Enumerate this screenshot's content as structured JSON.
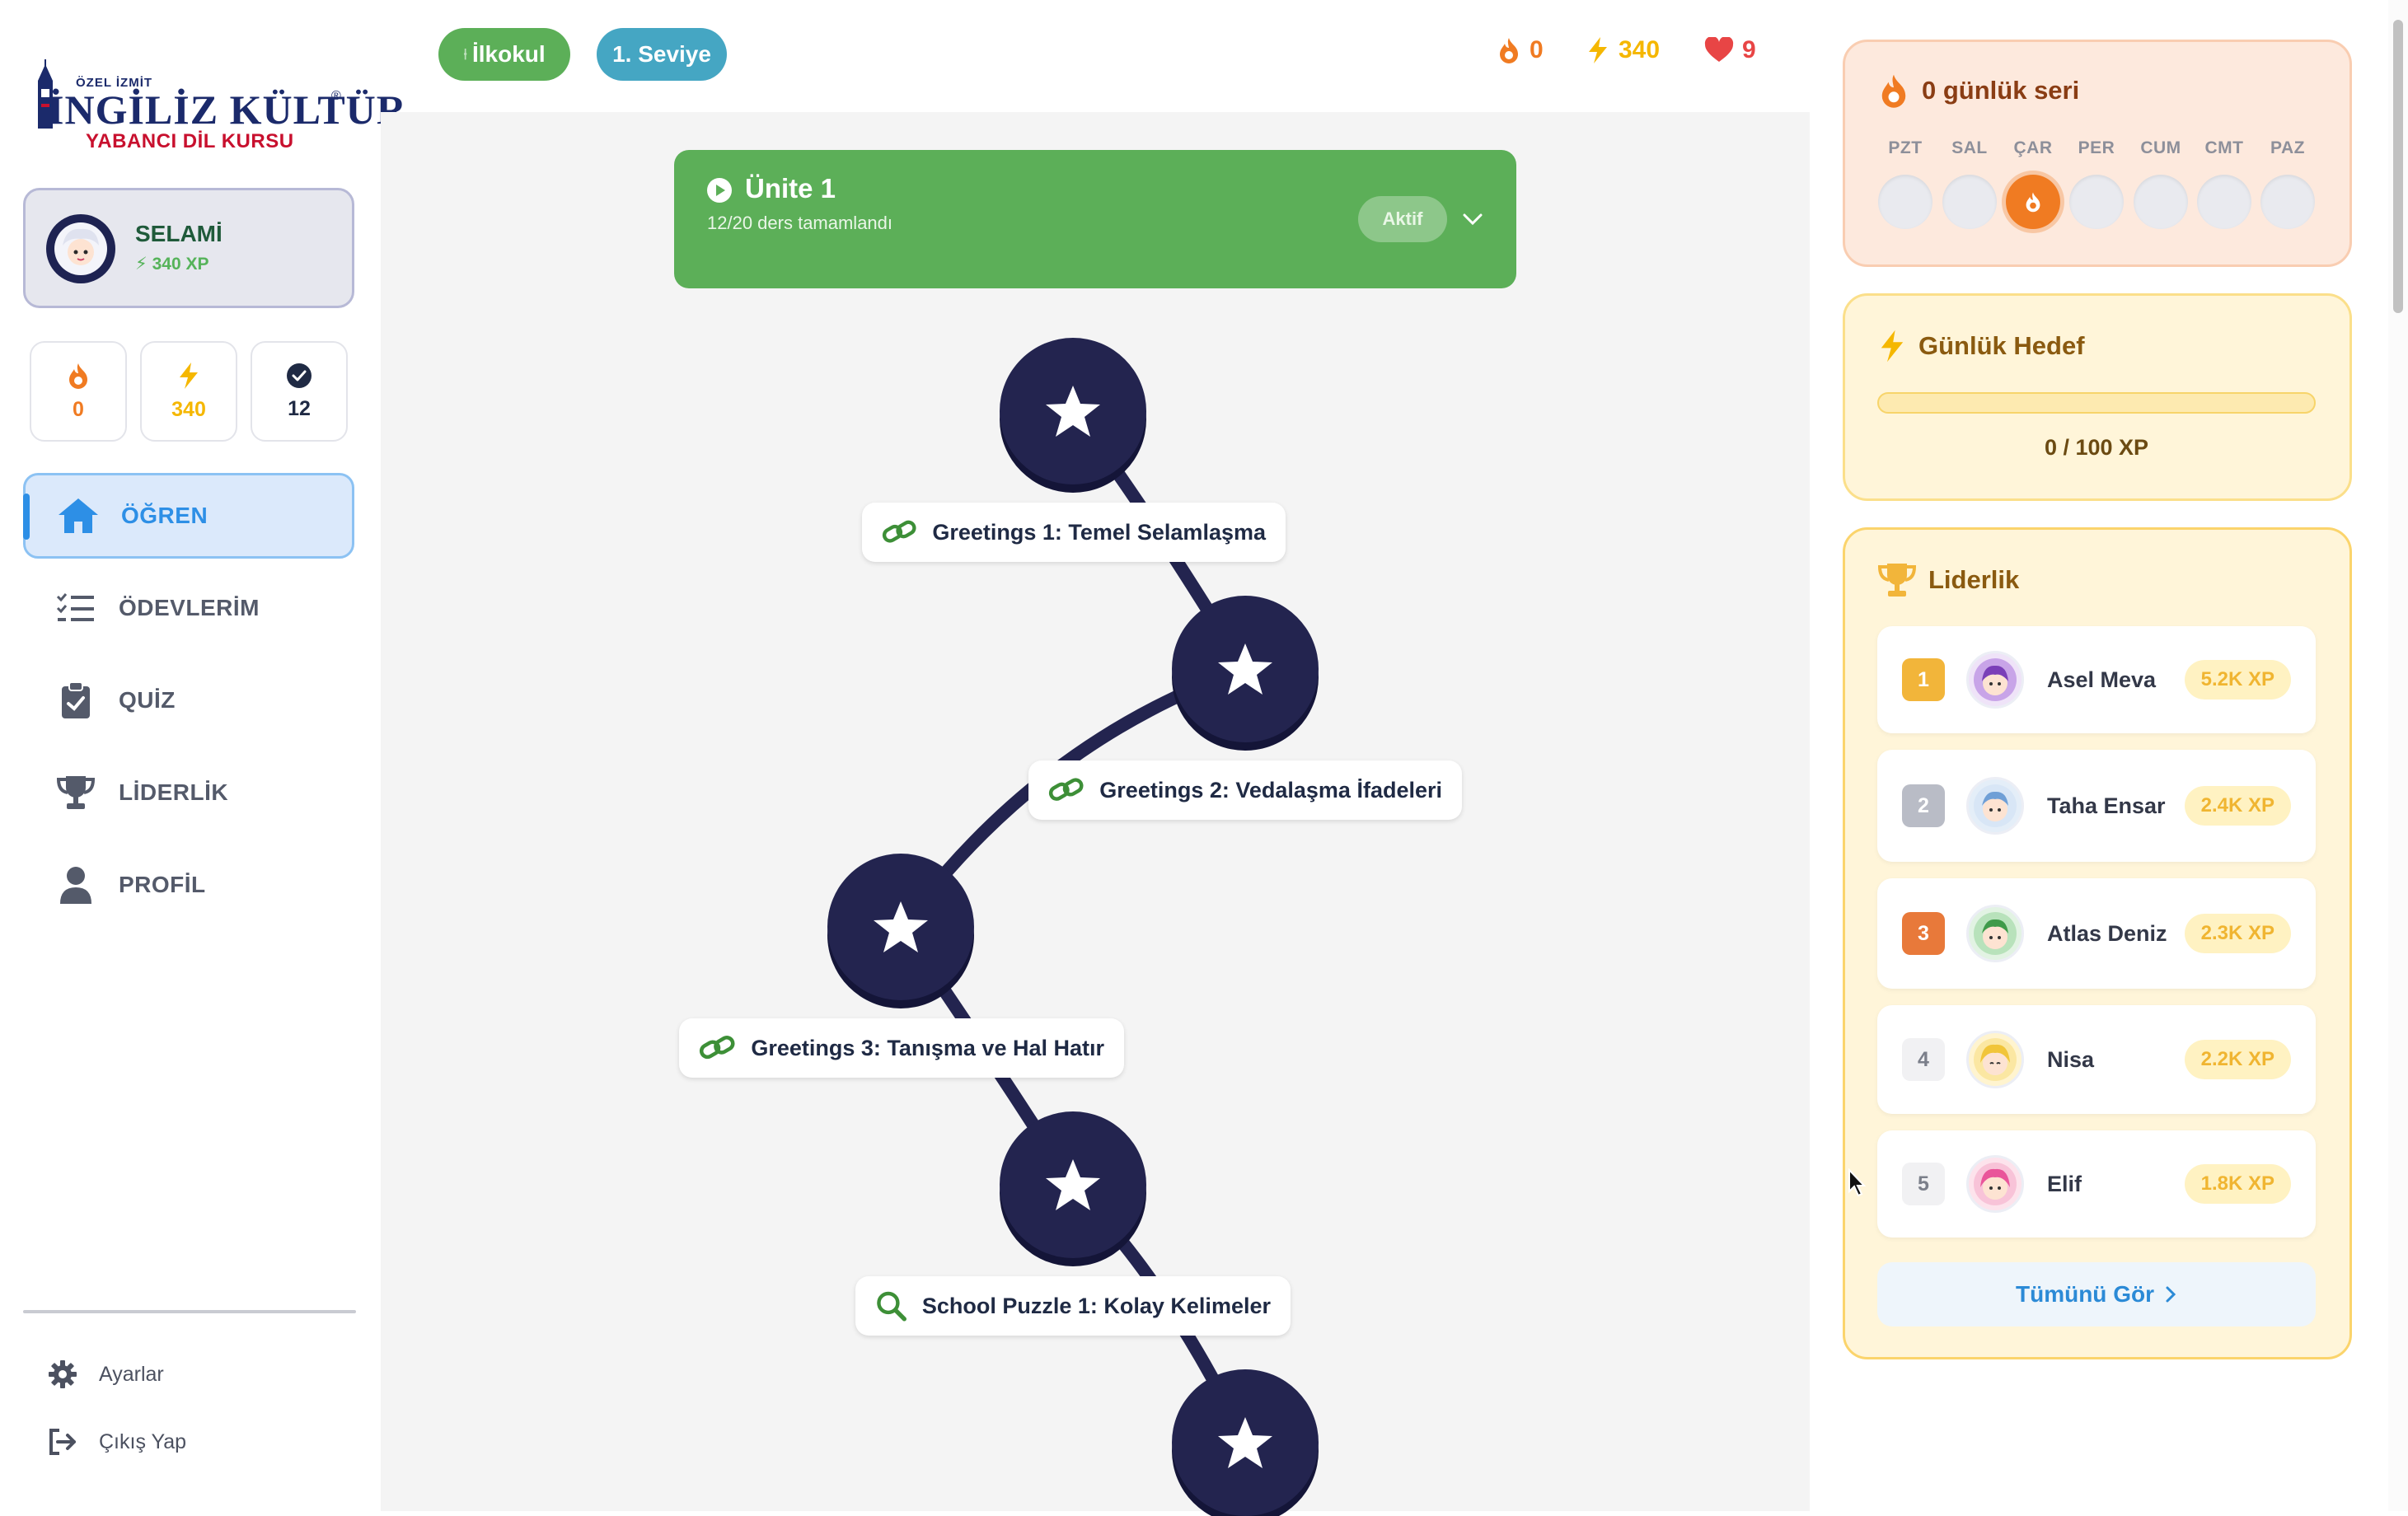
{
  "brand": {
    "top_line": "ÖZEL İZMİT",
    "main": "İNGİLİZ KÜLTÜR",
    "registered": "®",
    "sub": "YABANCI DİL KURSU"
  },
  "user": {
    "name": "SELAMİ",
    "xp": "340 XP"
  },
  "stats": [
    {
      "icon": "fire-icon",
      "value": "0",
      "color": "#f07b22"
    },
    {
      "icon": "lightning-icon",
      "value": "340",
      "color": "#f5b700"
    },
    {
      "icon": "check-circle-icon",
      "value": "12",
      "color": "#1f2a44"
    }
  ],
  "nav": [
    {
      "label": "ÖĞREN",
      "icon": "home-icon",
      "active": true
    },
    {
      "label": "ÖDEVLERİM",
      "icon": "checklist-icon",
      "active": false
    },
    {
      "label": "QUİZ",
      "icon": "clipboard-icon",
      "active": false
    },
    {
      "label": "LİDERLİK",
      "icon": "trophy-icon",
      "active": false
    },
    {
      "label": "PROFİL",
      "icon": "person-icon",
      "active": false
    }
  ],
  "footer": {
    "settings": "Ayarlar",
    "logout": "Çıkış Yap"
  },
  "topbar": {
    "school_pill": "İlkokul",
    "level_pill": "1. Seviye",
    "streak": "0",
    "xp": "340",
    "hearts": "9"
  },
  "unit": {
    "title": "Ünite 1",
    "progress_text": "12/20 ders tamamlandı",
    "status": "Aktif"
  },
  "lessons": [
    {
      "title": "Greetings 1: Temel Selamlaşma",
      "icon": "link-icon"
    },
    {
      "title": "Greetings 2: Vedalaşma İfadeleri",
      "icon": "link-icon"
    },
    {
      "title": "Greetings 3: Tanışma ve Hal Hatır",
      "icon": "link-icon"
    },
    {
      "title": "School Puzzle 1: Kolay Kelimeler",
      "icon": "search-icon"
    }
  ],
  "streak_panel": {
    "title": "0 günlük seri",
    "days": [
      "PZT",
      "SAL",
      "ÇAR",
      "PER",
      "CUM",
      "CMT",
      "PAZ"
    ],
    "active_day_index": 2
  },
  "goal_panel": {
    "title": "Günlük Hedef",
    "progress_text": "0 / 100 XP",
    "progress_fraction": 0
  },
  "leaderboard": {
    "title": "Liderlik",
    "rows": [
      {
        "rank": "1",
        "name": "Asel Meva",
        "xp": "5.2K XP",
        "rank_color": "#f2b53a"
      },
      {
        "rank": "2",
        "name": "Taha Ensar",
        "xp": "2.4K XP",
        "rank_color": "#b9bcc6"
      },
      {
        "rank": "3",
        "name": "Atlas Deniz",
        "xp": "2.3K XP",
        "rank_color": "#e8793a"
      },
      {
        "rank": "4",
        "name": "Nisa",
        "xp": "2.2K XP",
        "rank_color": "#f1f1f3"
      },
      {
        "rank": "5",
        "name": "Elif",
        "xp": "1.8K XP",
        "rank_color": "#f1f1f3"
      }
    ],
    "see_all": "Tümünü Gör"
  },
  "colors": {
    "accent_green": "#5caf58",
    "navy": "#23244f",
    "blue": "#2d8fe6",
    "orange": "#f07b22",
    "gold": "#f5b700"
  }
}
